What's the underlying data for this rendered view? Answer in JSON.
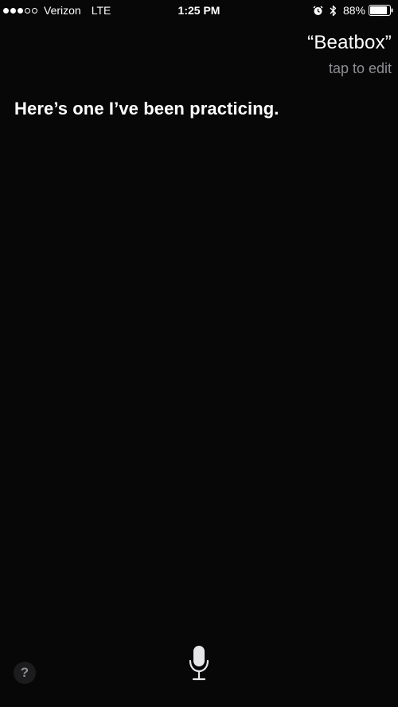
{
  "status_bar": {
    "carrier": "Verizon",
    "network": "LTE",
    "time": "1:25 PM",
    "battery_percent": "88%",
    "signal_bars_filled": 3,
    "signal_bars_total": 5,
    "battery_level": 0.88,
    "icons": [
      "alarm-icon",
      "bluetooth-icon",
      "battery-icon"
    ]
  },
  "siri": {
    "query": "“Beatbox”",
    "tap_to_edit": "tap to edit",
    "response": "Here’s one I’ve been practicing."
  },
  "controls": {
    "help_label": "?",
    "mic_icon": "microphone-icon"
  },
  "colors": {
    "background": "#070708",
    "primary_text": "#ffffff",
    "secondary_text": "#8e8e93"
  }
}
